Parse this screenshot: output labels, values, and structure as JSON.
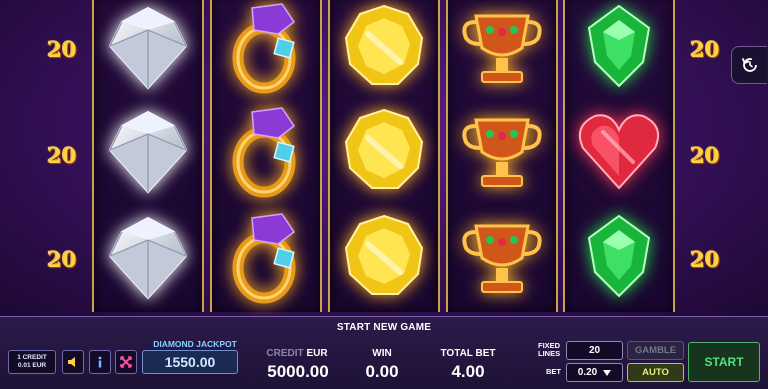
{
  "side_numbers": {
    "left": [
      "20",
      "20",
      "20"
    ],
    "right": [
      "20",
      "20",
      "20"
    ]
  },
  "reels": [
    {
      "symbols": [
        "diamond",
        "diamond",
        "diamond"
      ]
    },
    {
      "symbols": [
        "ring",
        "ring",
        "ring"
      ]
    },
    {
      "symbols": [
        "gold-coin",
        "gold-coin",
        "gold-coin"
      ]
    },
    {
      "symbols": [
        "trophy-cup",
        "trophy-cup",
        "trophy-cup"
      ]
    },
    {
      "symbols": [
        "green-gem",
        "red-heart",
        "green-gem"
      ]
    }
  ],
  "replay_icon": "replay-icon",
  "panel": {
    "start_new_game": "START NEW GAME",
    "credit_value": {
      "line1": "1 CREDIT",
      "line2": "0.01 EUR"
    },
    "icons": [
      "speaker-icon",
      "info-icon",
      "paytable-icon"
    ],
    "jackpot": {
      "label": "DIAMOND JACKPOT",
      "value": "1550.00"
    },
    "credit": {
      "label": "CREDIT",
      "unit": "EUR",
      "value": "5000.00"
    },
    "win": {
      "label": "WIN",
      "value": "0.00"
    },
    "total_bet": {
      "label": "TOTAL BET",
      "value": "4.00"
    },
    "fixed_lines": {
      "label_line1": "FIXED",
      "label_line2": "LINES",
      "value": "20"
    },
    "bet": {
      "label": "BET",
      "value": "0.20"
    },
    "gamble_label": "GAMBLE",
    "auto_label": "AUTO",
    "start_label": "START"
  },
  "colors": {
    "background": "#3a1260",
    "gold": "#ffd23f",
    "jackpot_text": "#7fd4ff",
    "start_green": "#53e07a",
    "auto_yellow": "#e8f07a"
  }
}
